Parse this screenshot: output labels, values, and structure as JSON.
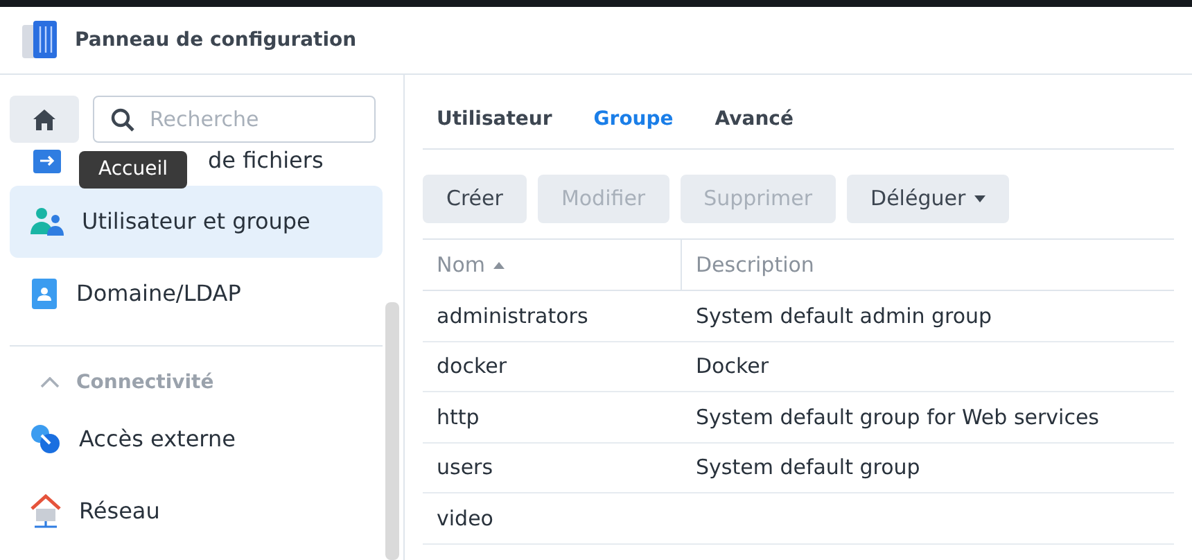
{
  "window": {
    "title": "Panneau de configuration"
  },
  "sidebar": {
    "home_tooltip": "Accueil",
    "search": {
      "placeholder": "Recherche"
    },
    "items": [
      {
        "kind": "partial",
        "label": "de fichiers"
      },
      {
        "kind": "item",
        "label": "Utilisateur et groupe",
        "selected": true
      },
      {
        "kind": "item",
        "label": "Domaine/LDAP",
        "selected": false
      },
      {
        "kind": "divider"
      },
      {
        "kind": "section",
        "label": "Connectivité",
        "expanded": true
      },
      {
        "kind": "item",
        "label": "Accès externe",
        "selected": false
      },
      {
        "kind": "item",
        "label": "Réseau",
        "selected": false
      }
    ]
  },
  "tabs": [
    {
      "label": "Utilisateur",
      "selected": false
    },
    {
      "label": "Groupe",
      "selected": true
    },
    {
      "label": "Avancé",
      "selected": false
    }
  ],
  "toolbar": [
    {
      "label": "Créer",
      "disabled": false,
      "dropdown": false
    },
    {
      "label": "Modifier",
      "disabled": true,
      "dropdown": false
    },
    {
      "label": "Supprimer",
      "disabled": true,
      "dropdown": false
    },
    {
      "label": "Déléguer",
      "disabled": false,
      "dropdown": true
    }
  ],
  "table": {
    "columns": [
      "Nom",
      "Description"
    ],
    "rows": [
      [
        "administrators",
        "System default admin group"
      ],
      [
        "docker",
        "Docker"
      ],
      [
        "http",
        "System default group for Web services"
      ],
      [
        "users",
        "System default group"
      ],
      [
        "video",
        ""
      ]
    ]
  }
}
